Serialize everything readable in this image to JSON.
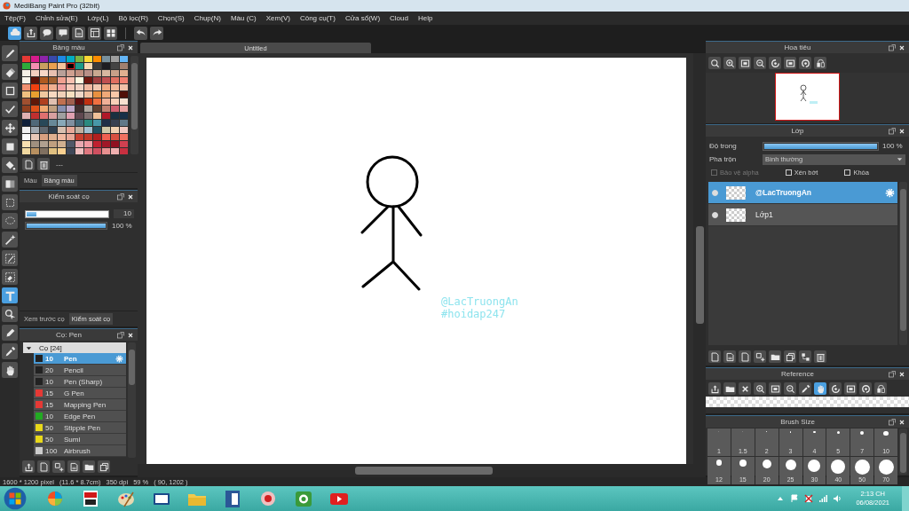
{
  "window": {
    "title": "MediBang Paint Pro (32bit)"
  },
  "menu": [
    "Tệp(F)",
    "Chỉnh sửa(E)",
    "Lớp(L)",
    "Bộ lọc(R)",
    "Chọn(S)",
    "Chụp(N)",
    "Màu (C)",
    "Xem(V)",
    "Công cụ(T)",
    "Cửa sổ(W)",
    "Cloud",
    "Help"
  ],
  "toolbar": [
    {
      "selected": true
    },
    {
      "selected": false
    },
    {
      "selected": false
    },
    {
      "selected": false
    },
    {
      "selected": false
    },
    {
      "selected": false
    },
    {
      "selected": false
    }
  ],
  "tools": [
    {
      "selected": false
    },
    {
      "selected": false
    },
    {
      "selected": false
    },
    {
      "selected": false
    },
    {
      "selected": false
    },
    {
      "selected": false
    },
    {
      "selected": false
    },
    {
      "selected": false
    },
    {
      "selected": false
    },
    {
      "selected": false
    },
    {
      "selected": false
    },
    {
      "selected": false
    },
    {
      "selected": false
    },
    {
      "selected": true
    },
    {
      "selected": false
    },
    {
      "selected": false
    },
    {
      "selected": false
    },
    {
      "selected": false
    }
  ],
  "color_panel": {
    "title": "Bảng màu",
    "swatch_rows": [
      [
        {
          "color": "#e53935",
          "selected": false
        },
        {
          "color": "#d81b8c",
          "selected": false
        },
        {
          "color": "#8e24aa",
          "selected": false
        },
        {
          "color": "#3949ab",
          "selected": false
        },
        {
          "color": "#1e88e5",
          "selected": false
        },
        {
          "color": "#00acc1",
          "selected": false
        },
        {
          "color": "#7cb342",
          "selected": false
        },
        {
          "color": "#fdd835",
          "selected": false
        },
        {
          "color": "#fb8c00",
          "selected": false
        },
        {
          "color": "#78909c",
          "selected": false
        },
        {
          "color": "#9e9e9e",
          "selected": false
        },
        {
          "color": "#64b5f6",
          "selected": false
        }
      ],
      [
        {
          "color": "#2eaa3a",
          "selected": false
        },
        {
          "color": "#f48fb1",
          "selected": false
        },
        {
          "color": "#c8a060",
          "selected": false
        },
        {
          "color": "#e9a050",
          "selected": false
        },
        {
          "color": "#f5c29a",
          "selected": false
        },
        {
          "color": "#000000",
          "selected": true
        },
        {
          "color": "#1a9a8a",
          "selected": false
        },
        {
          "color": "#f7d9b5",
          "selected": false
        },
        {
          "color": "#3a3a3a",
          "selected": false
        },
        {
          "color": "#1d1d22",
          "selected": false
        },
        {
          "color": "#444444",
          "selected": false
        },
        {
          "color": "#a08070",
          "selected": false
        }
      ],
      [
        {
          "color": "#f5f0e6",
          "selected": false
        },
        {
          "color": "#f2d0c0",
          "selected": false
        },
        {
          "color": "#f8d8c8",
          "selected": false
        },
        {
          "color": "#e8c0b0",
          "selected": false
        },
        {
          "color": "#b8a098",
          "selected": false
        },
        {
          "color": "#d0a090",
          "selected": false
        },
        {
          "color": "#c09080",
          "selected": false
        },
        {
          "color": "#b89088",
          "selected": false
        },
        {
          "color": "#c8a890",
          "selected": false
        },
        {
          "color": "#d8b8a0",
          "selected": false
        },
        {
          "color": "#c8a088",
          "selected": false
        },
        {
          "color": "#e0b090",
          "selected": false
        }
      ],
      [
        {
          "color": "#f8f4ea",
          "selected": false
        },
        {
          "color": "#5a1208",
          "selected": false
        },
        {
          "color": "#b05a20",
          "selected": false
        },
        {
          "color": "#a06030",
          "selected": false
        },
        {
          "color": "#f0a090",
          "selected": false
        },
        {
          "color": "#f8c0b0",
          "selected": false
        },
        {
          "color": "#fff8e0",
          "selected": false
        },
        {
          "color": "#701810",
          "selected": false
        },
        {
          "color": "#a04040",
          "selected": false
        },
        {
          "color": "#c05050",
          "selected": false
        },
        {
          "color": "#e07060",
          "selected": false
        },
        {
          "color": "#f08070",
          "selected": false
        }
      ],
      [
        {
          "color": "#f09070",
          "selected": false
        },
        {
          "color": "#f04010",
          "selected": false
        },
        {
          "color": "#f08858",
          "selected": false
        },
        {
          "color": "#f0b090",
          "selected": false
        },
        {
          "color": "#f0a0a0",
          "selected": false
        },
        {
          "color": "#f8c8b8",
          "selected": false
        },
        {
          "color": "#f0d0c0",
          "selected": false
        },
        {
          "color": "#f0b8a0",
          "selected": false
        },
        {
          "color": "#f0c8b0",
          "selected": false
        },
        {
          "color": "#f0a880",
          "selected": false
        },
        {
          "color": "#f0b898",
          "selected": false
        },
        {
          "color": "#f0c0a8",
          "selected": false
        }
      ],
      [
        {
          "color": "#f0c080",
          "selected": false
        },
        {
          "color": "#e8a030",
          "selected": false
        },
        {
          "color": "#f0c8a0",
          "selected": false
        },
        {
          "color": "#f8d8c0",
          "selected": false
        },
        {
          "color": "#f0d0b8",
          "selected": false
        },
        {
          "color": "#f8e0c0",
          "selected": false
        },
        {
          "color": "#f0d8c8",
          "selected": false
        },
        {
          "color": "#f0c0a0",
          "selected": false
        },
        {
          "color": "#e89040",
          "selected": false
        },
        {
          "color": "#f0a878",
          "selected": false
        },
        {
          "color": "#f8c8a8",
          "selected": false
        },
        {
          "color": "#501008",
          "selected": false
        }
      ],
      [
        {
          "color": "#a05030",
          "selected": false
        },
        {
          "color": "#601808",
          "selected": false
        },
        {
          "color": "#b04020",
          "selected": false
        },
        {
          "color": "#e0c0b0",
          "selected": false
        },
        {
          "color": "#c07050",
          "selected": false
        },
        {
          "color": "#a06050",
          "selected": false
        },
        {
          "color": "#601010",
          "selected": false
        },
        {
          "color": "#c03010",
          "selected": false
        },
        {
          "color": "#f07040",
          "selected": false
        },
        {
          "color": "#f0b098",
          "selected": false
        },
        {
          "color": "#f8d0b8",
          "selected": false
        },
        {
          "color": "#f8e0d0",
          "selected": false
        }
      ],
      [
        {
          "color": "#904020",
          "selected": false
        },
        {
          "color": "#e05018",
          "selected": false
        },
        {
          "color": "#f0a870",
          "selected": false
        },
        {
          "color": "#c0a080",
          "selected": false
        },
        {
          "color": "#8890b0",
          "selected": false
        },
        {
          "color": "#c0a8c8",
          "selected": false
        },
        {
          "color": "#403030",
          "selected": false
        },
        {
          "color": "#b0a8a0",
          "selected": false
        },
        {
          "color": "#604030",
          "selected": false
        },
        {
          "color": "#c08070",
          "selected": false
        },
        {
          "color": "#d06070",
          "selected": false
        },
        {
          "color": "#e8a0a0",
          "selected": false
        }
      ],
      [
        {
          "color": "#e0b0b0",
          "selected": false
        },
        {
          "color": "#c03030",
          "selected": false
        },
        {
          "color": "#e07070",
          "selected": false
        },
        {
          "color": "#d8a0a0",
          "selected": false
        },
        {
          "color": "#a0a0a0",
          "selected": false
        },
        {
          "color": "#e0a0b0",
          "selected": false
        },
        {
          "color": "#604850",
          "selected": false
        },
        {
          "color": "#807070",
          "selected": false
        },
        {
          "color": "#f0c098",
          "selected": false
        },
        {
          "color": "#b01828",
          "selected": false
        },
        {
          "color": "#1a3040",
          "selected": false
        },
        {
          "color": "#183048",
          "selected": false
        }
      ],
      [
        {
          "color": "#10203a",
          "selected": false
        },
        {
          "color": "#506878",
          "selected": false
        },
        {
          "color": "#284858",
          "selected": false
        },
        {
          "color": "#688898",
          "selected": false
        },
        {
          "color": "#88a8b8",
          "selected": false
        },
        {
          "color": "#8090a0",
          "selected": false
        },
        {
          "color": "#406878",
          "selected": false
        },
        {
          "color": "#2a8a80",
          "selected": false
        },
        {
          "color": "#4898a8",
          "selected": false
        },
        {
          "color": "#203048",
          "selected": false
        },
        {
          "color": "#384050",
          "selected": false
        },
        {
          "color": "#607888",
          "selected": false
        }
      ],
      [
        {
          "color": "#f0f0f0",
          "selected": false
        },
        {
          "color": "#a0a8b0",
          "selected": false
        },
        {
          "color": "#606870",
          "selected": false
        },
        {
          "color": "#304050",
          "selected": false
        },
        {
          "color": "#d8c0b0",
          "selected": false
        },
        {
          "color": "#e8a898",
          "selected": false
        },
        {
          "color": "#c0b0a0",
          "selected": false
        },
        {
          "color": "#a0c0d0",
          "selected": false
        },
        {
          "color": "#205060",
          "selected": false
        },
        {
          "color": "#d0c8a8",
          "selected": false
        },
        {
          "color": "#f0d0b0",
          "selected": false
        },
        {
          "color": "#f0c8c0",
          "selected": false
        }
      ],
      [
        {
          "color": "#f8f8f8",
          "selected": false
        },
        {
          "color": "#e8c8b8",
          "selected": false
        },
        {
          "color": "#d8a080",
          "selected": false
        },
        {
          "color": "#e0b090",
          "selected": false
        },
        {
          "color": "#f0b8a0",
          "selected": false
        },
        {
          "color": "#e8a898",
          "selected": false
        },
        {
          "color": "#c84030",
          "selected": false
        },
        {
          "color": "#c03828",
          "selected": false
        },
        {
          "color": "#b02020",
          "selected": false
        },
        {
          "color": "#f06050",
          "selected": false
        },
        {
          "color": "#d85040",
          "selected": false
        },
        {
          "color": "#f07060",
          "selected": false
        }
      ],
      [
        {
          "color": "#f8e0b0",
          "selected": false
        },
        {
          "color": "#a09080",
          "selected": false
        },
        {
          "color": "#b0a090",
          "selected": false
        },
        {
          "color": "#c0a080",
          "selected": false
        },
        {
          "color": "#d0b090",
          "selected": false
        },
        {
          "color": "#505868",
          "selected": false
        },
        {
          "color": "#e8a8b0",
          "selected": false
        },
        {
          "color": "#f098a0",
          "selected": false
        },
        {
          "color": "#c02030",
          "selected": false
        },
        {
          "color": "#a01828",
          "selected": false
        },
        {
          "color": "#901020",
          "selected": false
        },
        {
          "color": "#d04050",
          "selected": false
        }
      ],
      [
        {
          "color": "#f0d8a0",
          "selected": false
        },
        {
          "color": "#b89060",
          "selected": false
        },
        {
          "color": "#807060",
          "selected": false
        },
        {
          "color": "#e0c080",
          "selected": false
        },
        {
          "color": "#f8d090",
          "selected": false
        },
        {
          "color": "#404858",
          "selected": false
        },
        {
          "color": "#f0c0c0",
          "selected": false
        },
        {
          "color": "#e07880",
          "selected": false
        },
        {
          "color": "#d05060",
          "selected": false
        },
        {
          "color": "#e89090",
          "selected": false
        },
        {
          "color": "#f0b0b0",
          "selected": false
        },
        {
          "color": "#c83040",
          "selected": false
        }
      ]
    ],
    "footer_label": "---",
    "tabs": [
      {
        "label": "Màu",
        "selected": false
      },
      {
        "label": "Bảng màu",
        "selected": true
      }
    ]
  },
  "brush_control": {
    "title": "Kiểm soát cọ",
    "size": {
      "level": 0.12,
      "value": "10"
    },
    "opacity": {
      "level": 1,
      "reading": "100 %"
    },
    "tabs": [
      {
        "label": "Xem trước cọ",
        "selected": false
      },
      {
        "label": "Kiểm soát cọ",
        "selected": true
      }
    ]
  },
  "brush_list": {
    "title": "Cọ: Pen",
    "group": {
      "label": "Cọ [24]",
      "expanded": true
    },
    "items": [
      {
        "color": "#222222",
        "size": "10",
        "name": "Pen",
        "selected": true
      },
      {
        "color": "#222222",
        "size": "20",
        "name": "Pencil",
        "selected": false
      },
      {
        "color": "#222222",
        "size": "10",
        "name": "Pen (Sharp)",
        "selected": false
      },
      {
        "color": "#e53935",
        "size": "15",
        "name": "G Pen",
        "selected": false
      },
      {
        "color": "#e53935",
        "size": "15",
        "name": "Mapping Pen",
        "selected": false
      },
      {
        "color": "#22aa22",
        "size": "10",
        "name": "Edge Pen",
        "selected": false
      },
      {
        "color": "#e8d81a",
        "size": "50",
        "name": "Stipple Pen",
        "selected": false
      },
      {
        "color": "#e8d81a",
        "size": "50",
        "name": "Sumi",
        "selected": false
      },
      {
        "color": "#cccccc",
        "size": "100",
        "name": "Airbrush",
        "selected": false
      }
    ]
  },
  "document": {
    "tab": "Untitled",
    "canvas_texts": [
      "@LacTruongAn",
      "#hoidap247"
    ]
  },
  "navigator": {
    "title": "Hoa tiêu"
  },
  "layers": {
    "title": "Lớp",
    "opacity": {
      "label": "Độ trong",
      "level": 1,
      "reading": "100 %"
    },
    "blend": {
      "label": "Pha trộn",
      "value": "Bình thường"
    },
    "options": [
      {
        "label": "Bảo vệ alpha",
        "checked": false,
        "disabled": true
      },
      {
        "label": "Xén bớt",
        "checked": false,
        "disabled": false
      },
      {
        "label": "Khóa",
        "checked": false,
        "disabled": false
      }
    ],
    "items": [
      {
        "name": "@LacTruongAn",
        "selected": true,
        "visible": true
      },
      {
        "name": "Lớp1",
        "selected": false,
        "visible": true
      }
    ]
  },
  "reference": {
    "title": "Reference",
    "buttons": [
      {
        "selected": false
      },
      {
        "selected": false
      },
      {
        "selected": false
      },
      {
        "selected": false
      },
      {
        "selected": false
      },
      {
        "selected": false
      },
      {
        "selected": false
      },
      {
        "selected": true
      },
      {
        "selected": false
      },
      {
        "selected": false
      },
      {
        "selected": false
      },
      {
        "selected": false
      }
    ]
  },
  "brush_size": {
    "title": "Brush Size",
    "sizes": [
      "1",
      "1.5",
      "2",
      "3",
      "4",
      "5",
      "7",
      "10",
      "12",
      "15",
      "20",
      "25",
      "30",
      "40",
      "50",
      "70"
    ]
  },
  "status_bar": {
    "size": "1600 * 1200 pixel",
    "physical": "(11.6 * 8.7cm)",
    "dpi": "350 dpi",
    "zoom": "59 %",
    "cursor": "( 90, 1202 )"
  },
  "taskbar": {
    "time": "2:13 CH",
    "date": "06/08/2021"
  }
}
